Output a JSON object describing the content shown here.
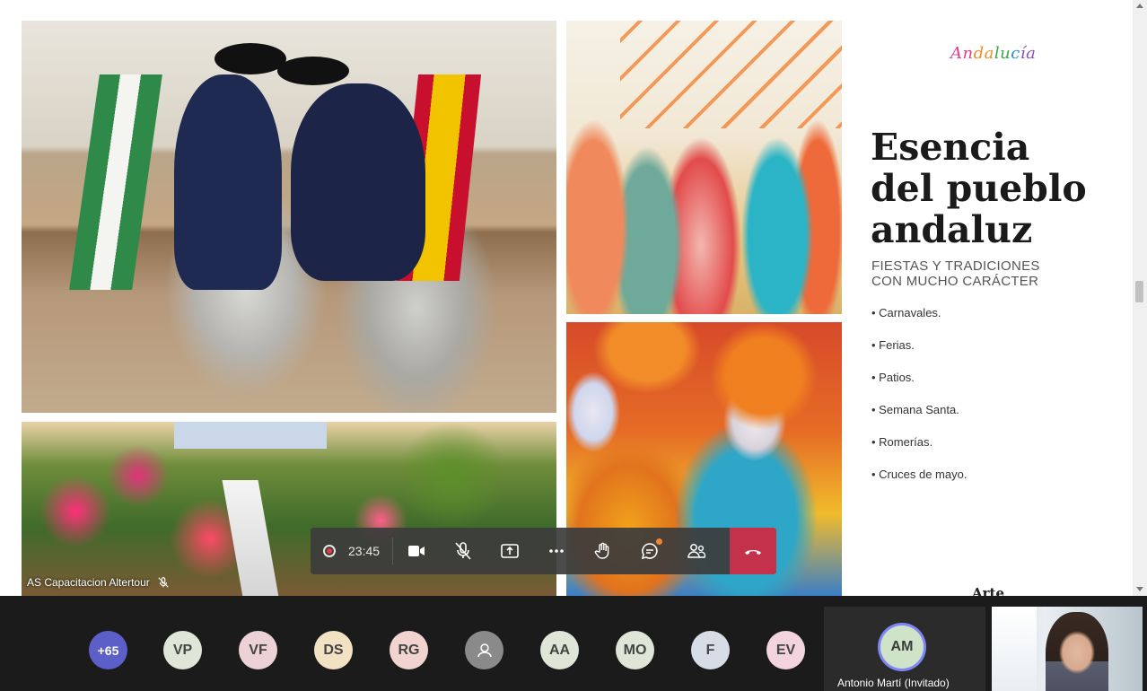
{
  "slide": {
    "logo_parts": [
      "An",
      "da",
      "lu",
      "c",
      "ía"
    ],
    "title_lines": [
      "Esencia",
      "del pueblo",
      "andaluz"
    ],
    "subtitle_lines": [
      "FIESTAS Y TRADICIONES",
      "CON MUCHO CARÁCTER"
    ],
    "bullets": [
      "Carnavales.",
      "Ferias.",
      "Patios.",
      "Semana Santa.",
      "Romerías.",
      "Cruces de mayo."
    ],
    "next_heading": "Arte"
  },
  "presenter": {
    "name": "AS Capacitacion Altertour"
  },
  "toolbar": {
    "timer": "23:45",
    "items": [
      "video-camera",
      "microphone-muted",
      "share-screen",
      "more-options",
      "raise-hand",
      "chat",
      "participants",
      "hang-up"
    ]
  },
  "participants": {
    "overflow": "+65",
    "avatars": [
      {
        "initials": "VP",
        "color": "#dfe6d7"
      },
      {
        "initials": "VF",
        "color": "#ecd2d6"
      },
      {
        "initials": "DS",
        "color": "#f3e1c4"
      },
      {
        "initials": "RG",
        "color": "#f1d3cf"
      },
      {
        "initials": "",
        "color": "#8a8a8a"
      },
      {
        "initials": "AA",
        "color": "#dfe6d7"
      },
      {
        "initials": "MO",
        "color": "#dfe6d7"
      },
      {
        "initials": "F",
        "color": "#d6dde6"
      },
      {
        "initials": "EV",
        "color": "#f2d3de"
      }
    ],
    "active_speaker": {
      "initials": "AM",
      "name": "Antonio Martí (Invitado)"
    }
  },
  "colors": {
    "toolbar_bg": "#3c3c3c",
    "hangup": "#c4314b",
    "overflow_badge": "#5b5fc7",
    "speaker_ring": "#7f85f5"
  }
}
